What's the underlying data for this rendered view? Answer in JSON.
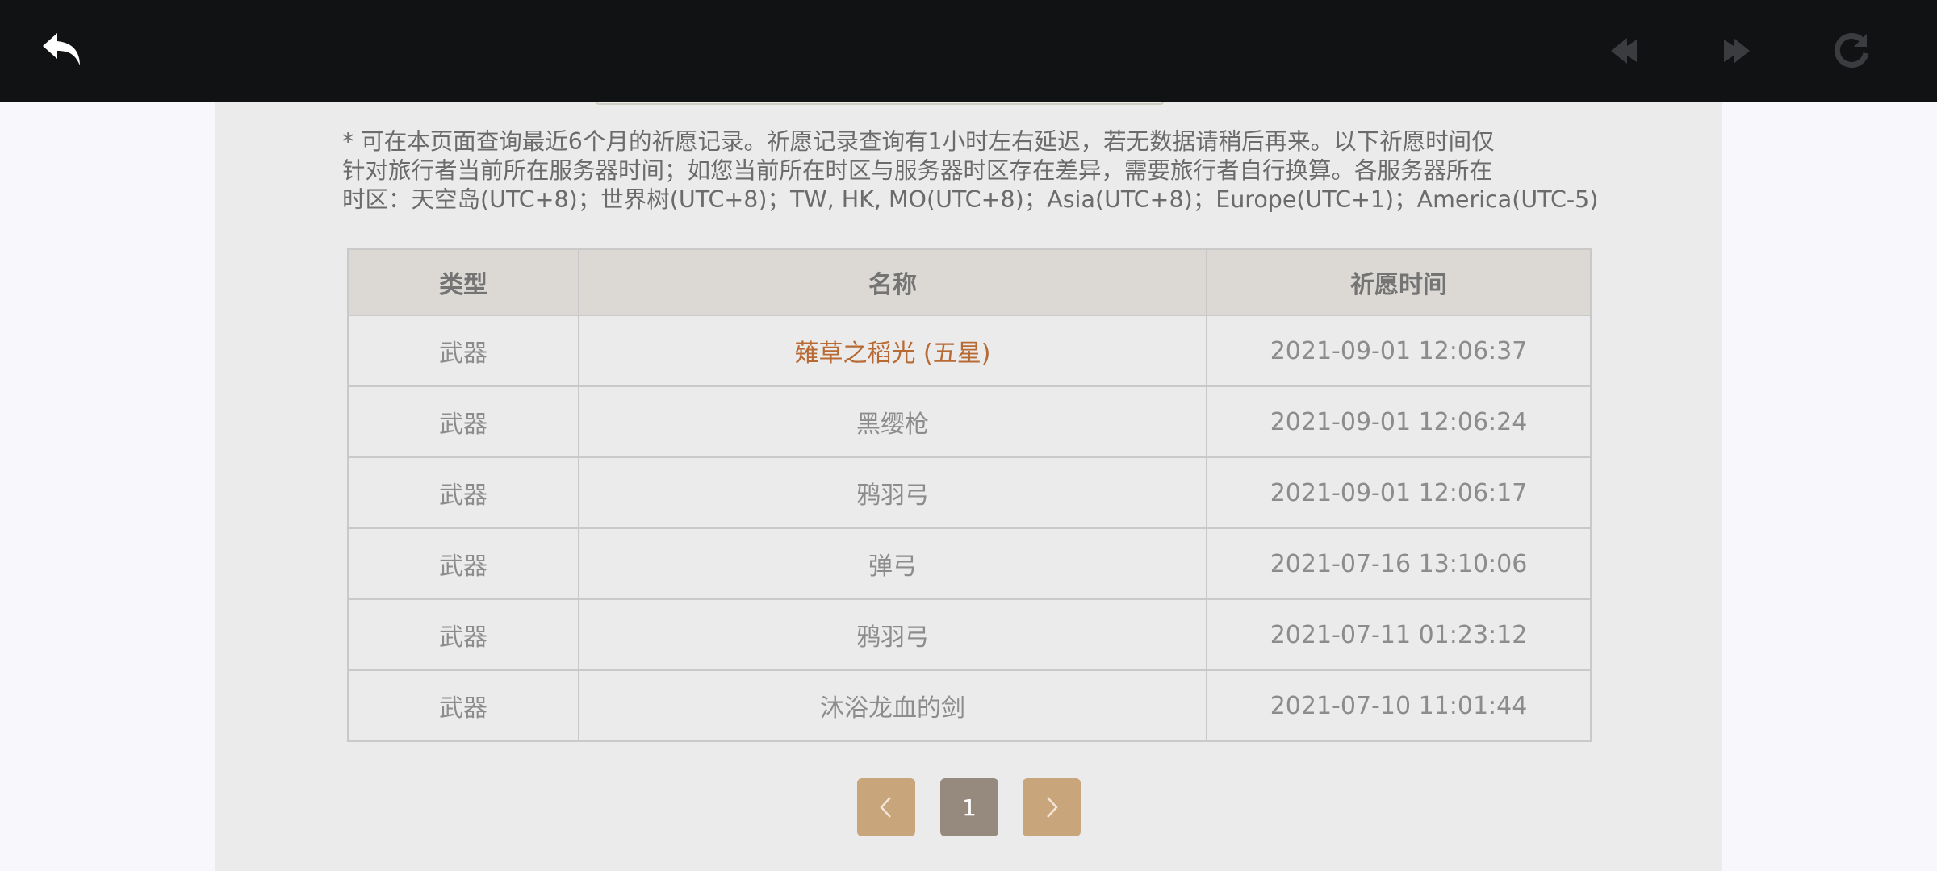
{
  "toolbar": {
    "icons": [
      "back-icon",
      "nav-prev-icon",
      "nav-next-icon",
      "refresh-icon"
    ],
    "colors": {
      "bar": "#111214",
      "active": "#ffffff",
      "disabled": "#3a3c40"
    }
  },
  "notice": {
    "line1": "* 可在本页面查询最近6个月的祈愿记录。祈愿记录查询有1小时左右延迟，若无数据请稍后再来。以下祈愿时间仅",
    "line2": "针对旅行者当前所在服务器时间；如您当前所在时区与服务器时区存在差异，需要旅行者自行换算。各服务器所在",
    "line3": "时区：天空岛(UTC+8)；世界树(UTC+8)；TW, HK, MO(UTC+8)；Asia(UTC+8)；Europe(UTC+1)；America(UTC-5)"
  },
  "table": {
    "headers": [
      "类型",
      "名称",
      "祈愿时间"
    ],
    "rows": [
      {
        "type": "武器",
        "name": "薙草之稻光 (五星)",
        "time": "2021-09-01 12:06:37",
        "rarity": "five-star"
      },
      {
        "type": "武器",
        "name": "黑缨枪",
        "time": "2021-09-01 12:06:24",
        "rarity": "normal"
      },
      {
        "type": "武器",
        "name": "鸦羽弓",
        "time": "2021-09-01 12:06:17",
        "rarity": "normal"
      },
      {
        "type": "武器",
        "name": "弹弓",
        "time": "2021-07-16 13:10:06",
        "rarity": "normal"
      },
      {
        "type": "武器",
        "name": "鸦羽弓",
        "time": "2021-07-11 01:23:12",
        "rarity": "normal"
      },
      {
        "type": "武器",
        "name": "沐浴龙血的剑",
        "time": "2021-07-10 11:01:44",
        "rarity": "normal"
      }
    ],
    "colors": {
      "header_bg": "#dcd9d4",
      "five_star": "#b86a34",
      "text": "#8c8c8c"
    }
  },
  "pagination": {
    "current_page": "1",
    "icons": [
      "chevron-left-icon",
      "chevron-right-icon"
    ],
    "colors": {
      "arrow_bg": "#c9a57b",
      "current_bg": "#968a7f"
    }
  }
}
